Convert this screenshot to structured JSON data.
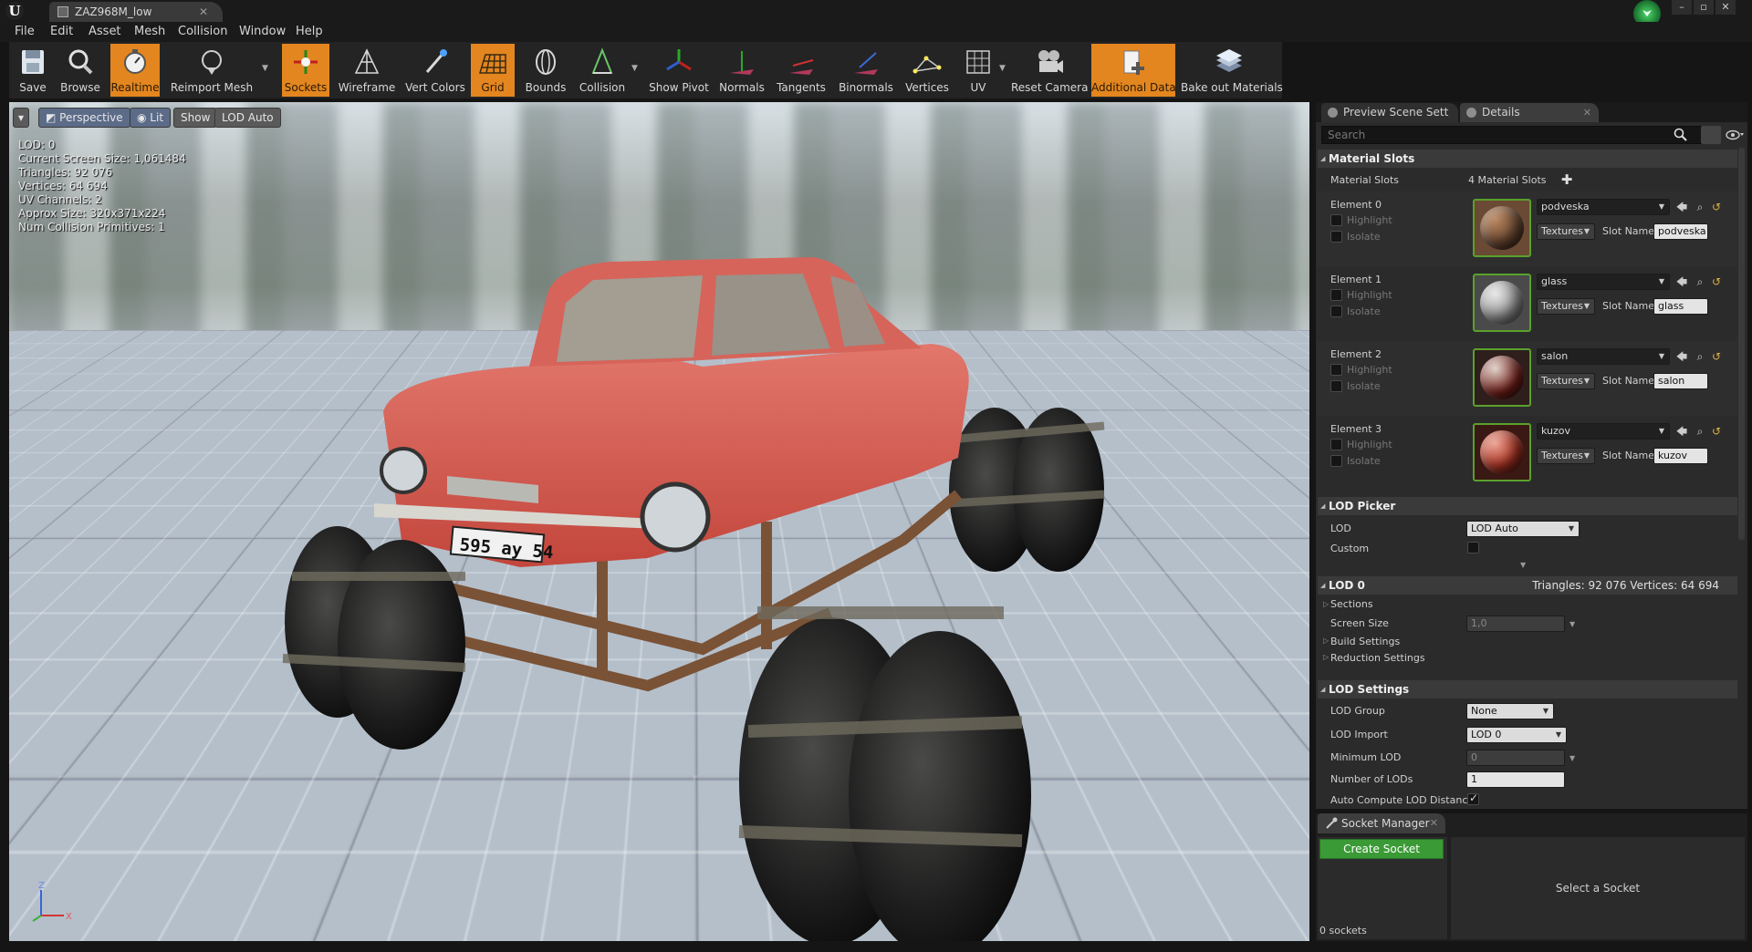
{
  "window": {
    "doc_tab": "ZAZ968M_low",
    "minimize": "–",
    "restore": "▫",
    "close": "✕"
  },
  "menu": [
    "File",
    "Edit",
    "Asset",
    "Mesh",
    "Collision",
    "Window",
    "Help"
  ],
  "toolbar": {
    "save": "Save",
    "browse": "Browse",
    "realtime": "Realtime",
    "reimport": "Reimport Mesh",
    "sockets": "Sockets",
    "wireframe": "Wireframe",
    "vert_colors": "Vert Colors",
    "grid": "Grid",
    "bounds": "Bounds",
    "collision": "Collision",
    "show_pivot": "Show Pivot",
    "normals": "Normals",
    "tangents": "Tangents",
    "binormals": "Binormals",
    "vertices": "Vertices",
    "uv": "UV",
    "reset_camera": "Reset Camera",
    "additional_data": "Additional Data",
    "bake_out": "Bake out Materials",
    "accent": "#e3861f"
  },
  "viewport": {
    "perspective": "Perspective",
    "lit": "Lit",
    "show": "Show",
    "lod": "LOD Auto",
    "stats": [
      "LOD:  0",
      "Current Screen Size:  1,061484",
      "Triangles:  92 076",
      "Vertices:  64 694",
      "UV Channels:  2",
      "Approx Size: 320x371x224",
      "Num Collision Primitives:  1"
    ],
    "plate": "595 ау 54",
    "axis": {
      "x": "X",
      "z": "Z"
    }
  },
  "details": {
    "tab_preview": "Preview Scene Sett",
    "tab_details": "Details",
    "search_placeholder": "Search",
    "material_slots_header": "Material Slots",
    "material_slots_label": "Material Slots",
    "material_slots_count": "4 Material Slots",
    "highlight": "Highlight",
    "isolate": "Isolate",
    "textures": "Textures",
    "slot_name_label": "Slot Name",
    "elements": [
      {
        "label": "Element 0",
        "material": "podveska",
        "slot_name": "podveska"
      },
      {
        "label": "Element 1",
        "material": "glass",
        "slot_name": "glass"
      },
      {
        "label": "Element 2",
        "material": "salon",
        "slot_name": "salon"
      },
      {
        "label": "Element 3",
        "material": "kuzov",
        "slot_name": "kuzov"
      }
    ],
    "lod_picker_header": "LOD Picker",
    "lod_label": "LOD",
    "lod_value": "LOD Auto",
    "custom_label": "Custom",
    "lod0_header": "LOD 0",
    "lod0_stats": "Triangles: 92 076    Vertices: 64 694",
    "sections": "Sections",
    "screen_size": "Screen Size",
    "screen_size_value": "1,0",
    "build_settings": "Build Settings",
    "reduction_settings": "Reduction Settings",
    "lod_settings_header": "LOD Settings",
    "lod_group": "LOD Group",
    "lod_group_value": "None",
    "lod_import": "LOD Import",
    "lod_import_value": "LOD 0",
    "minimum_lod": "Minimum LOD",
    "minimum_lod_value": "0",
    "number_of_lods": "Number of LODs",
    "number_of_lods_value": "1",
    "auto_compute": "Auto Compute LOD Distance"
  },
  "socket_manager": {
    "tab": "Socket Manager",
    "create": "Create Socket",
    "select": "Select a Socket",
    "count": "0 sockets"
  }
}
